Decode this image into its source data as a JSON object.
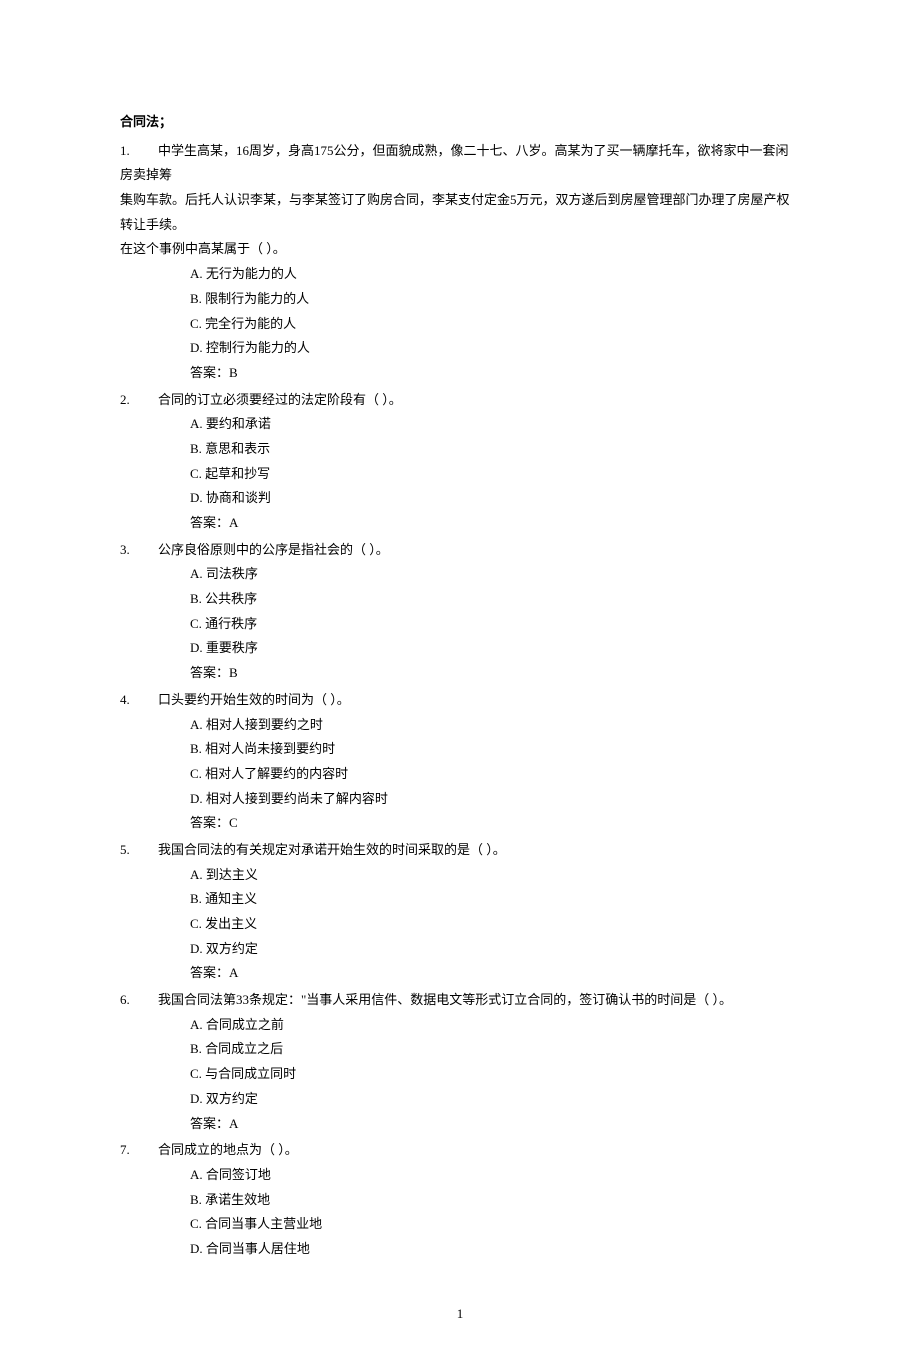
{
  "title": "合同法；",
  "questions": [
    {
      "num": "1.",
      "stem_lines": [
        "中学生高某，16周岁，身高175公分，但面貌成熟，像二十七、八岁。高某为了买一辆摩托车，欲将家中一套闲房卖掉筹",
        "集购车款。后托人认识李某，与李某签订了购房合同，李某支付定金5万元，双方遂后到房屋管理部门办理了房屋产权转让手续。",
        "在这个事例中高某属于（   ）。"
      ],
      "options": [
        "A.  无行为能力的人",
        "B.  限制行为能力的人",
        "C.  完全行为能的人",
        "D.  控制行为能力的人"
      ],
      "answer": "答案：B"
    },
    {
      "num": "2.",
      "stem_lines": [
        "合同的订立必须要经过的法定阶段有（   ）。"
      ],
      "options": [
        "A.  要约和承诺",
        "B.  意思和表示",
        "C.  起草和抄写",
        "D.  协商和谈判"
      ],
      "answer": "答案：A"
    },
    {
      "num": "3.",
      "stem_lines": [
        "公序良俗原则中的公序是指社会的（   ）。"
      ],
      "options": [
        "A.  司法秩序",
        "B.  公共秩序",
        "C.  通行秩序",
        "D.  重要秩序"
      ],
      "answer": "答案：B"
    },
    {
      "num": "4.",
      "stem_lines": [
        "口头要约开始生效的时间为（   ）。"
      ],
      "options": [
        "A.  相对人接到要约之时",
        "B.  相对人尚未接到要约时",
        "C.  相对人了解要约的内容时",
        "D.  相对人接到要约尚未了解内容时"
      ],
      "answer": "答案：C"
    },
    {
      "num": "5.",
      "stem_lines": [
        "我国合同法的有关规定对承诺开始生效的时间采取的是（   ）。"
      ],
      "options": [
        "A.  到达主义",
        "B.  通知主义",
        "C.  发出主义",
        "D.  双方约定"
      ],
      "answer": "答案：A"
    },
    {
      "num": "6.",
      "stem_lines": [
        "我国合同法第33条规定：\"当事人采用信件、数据电文等形式订立合同的，签订确认书的时间是（   ）。"
      ],
      "options": [
        "A.  合同成立之前",
        "B.  合同成立之后",
        "C.  与合同成立同时",
        "D.  双方约定"
      ],
      "answer": "答案：A"
    },
    {
      "num": "7.",
      "stem_lines": [
        "合同成立的地点为（   ）。"
      ],
      "options": [
        "A.  合同签订地",
        "B.  承诺生效地",
        "C.  合同当事人主营业地",
        "D.  合同当事人居住地"
      ],
      "answer": ""
    }
  ],
  "page_number": "1"
}
